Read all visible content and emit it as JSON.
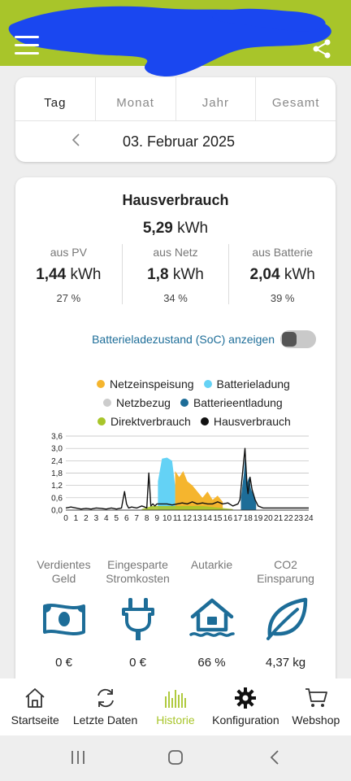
{
  "tabs": [
    {
      "label": "Tag",
      "active": true
    },
    {
      "label": "Monat",
      "active": false
    },
    {
      "label": "Jahr",
      "active": false
    },
    {
      "label": "Gesamt",
      "active": false
    }
  ],
  "date": "03. Februar 2025",
  "consumption": {
    "title": "Hausverbrauch",
    "total_value": "5,29",
    "unit": "kWh",
    "sources": [
      {
        "label": "aus PV",
        "value": "1,44",
        "unit": "kWh",
        "percent": "27 %"
      },
      {
        "label": "aus Netz",
        "value": "1,8",
        "unit": "kWh",
        "percent": "34 %"
      },
      {
        "label": "aus Batterie",
        "value": "2,04",
        "unit": "kWh",
        "percent": "39 %"
      }
    ]
  },
  "soc_toggle": {
    "label": "Batterieladezustand (SoC) anzeigen",
    "on": false
  },
  "legend": [
    {
      "name": "Netzeinspeisung",
      "color": "#f5b52e"
    },
    {
      "name": "Batterieladung",
      "color": "#64d2f5"
    },
    {
      "name": "Netzbezug",
      "color": "#cccccc"
    },
    {
      "name": "Batterieentladung",
      "color": "#1d6d98"
    },
    {
      "name": "Direktverbrauch",
      "color": "#a8c52a"
    },
    {
      "name": "Hausverbrauch",
      "color": "#111111"
    }
  ],
  "chart_data": {
    "type": "area",
    "x_ticks": [
      "0",
      "1",
      "2",
      "3",
      "4",
      "5",
      "6",
      "7",
      "8",
      "9",
      "10",
      "11",
      "12",
      "13",
      "14",
      "15",
      "16",
      "17",
      "18",
      "19",
      "20",
      "21",
      "22",
      "23",
      "24"
    ],
    "y_ticks": [
      "0,0",
      "0,6",
      "1,2",
      "1,8",
      "2,4",
      "3,0",
      "3,6"
    ],
    "ylim": [
      0,
      3.6
    ],
    "xlim": [
      0,
      24
    ],
    "grid": true,
    "series": [
      {
        "name": "Hausverbrauch",
        "x": [
          0,
          0.5,
          1,
          1.5,
          2,
          2.5,
          3,
          3.5,
          4,
          4.5,
          5,
          5.5,
          5.8,
          6,
          6.2,
          6.5,
          7,
          7.5,
          7.8,
          8,
          8.2,
          8.4,
          8.6,
          8.8,
          9,
          9.5,
          10,
          10.5,
          11,
          11.5,
          12,
          12.5,
          13,
          13.5,
          14,
          14.5,
          15,
          15.5,
          16,
          16.5,
          17,
          17.2,
          17.5,
          17.7,
          17.9,
          18,
          18.2,
          18.4,
          18.7,
          19,
          19.5,
          20,
          21,
          22,
          23,
          24
        ],
        "y": [
          0.1,
          0.15,
          0.1,
          0.05,
          0.08,
          0.05,
          0.1,
          0.08,
          0.05,
          0.1,
          0.05,
          0.1,
          0.9,
          0.3,
          0.1,
          0.15,
          0.1,
          0.2,
          0.15,
          0.1,
          1.8,
          0.2,
          0.3,
          0.2,
          0.3,
          0.3,
          0.3,
          0.25,
          0.3,
          0.35,
          0.3,
          0.4,
          0.3,
          0.35,
          0.3,
          0.3,
          0.4,
          0.3,
          0.35,
          0.2,
          0.3,
          0.5,
          2.0,
          3.0,
          1.2,
          0.8,
          1.6,
          1.0,
          0.5,
          0.2,
          0.1,
          0.1,
          0.1,
          0.1,
          0.1,
          0.1
        ]
      },
      {
        "name": "Batterieladung",
        "x": [
          9.1,
          9.5,
          10,
          10.5,
          10.8
        ],
        "y": [
          1.4,
          2.5,
          2.55,
          2.4,
          1.2
        ]
      },
      {
        "name": "Netzeinspeisung",
        "x": [
          10.8,
          11.2,
          11.6,
          12,
          12.5,
          13,
          13.5,
          14,
          14.5,
          15,
          15.5
        ],
        "y": [
          1.9,
          1.6,
          1.9,
          1.4,
          1.2,
          0.9,
          0.6,
          0.9,
          0.5,
          0.7,
          0.4
        ]
      },
      {
        "name": "Batterieentladung",
        "x": [
          17.3,
          17.6,
          17.75,
          17.9,
          18.1,
          18.3,
          18.5,
          18.8
        ],
        "y": [
          0.6,
          1.8,
          2.9,
          1.3,
          1.6,
          1.0,
          0.8,
          0.3
        ]
      },
      {
        "name": "Direktverbrauch",
        "x": [
          7.5,
          8.5,
          9.5,
          10.5,
          11.5,
          12.5,
          13.5,
          14.5,
          15.5,
          16.5
        ],
        "y": [
          0.05,
          0.2,
          0.2,
          0.2,
          0.2,
          0.2,
          0.2,
          0.15,
          0.1,
          0.05
        ]
      }
    ]
  },
  "kpis": [
    {
      "label": "Verdientes Geld",
      "value": "0 €",
      "icon": "money-icon"
    },
    {
      "label": "Eingesparte Stromkosten",
      "value": "0 €",
      "icon": "plug-icon"
    },
    {
      "label": "Autarkie",
      "value": "66 %",
      "icon": "house-icon"
    },
    {
      "label": "CO2 Einsparung",
      "value": "4,37 kg",
      "icon": "leaf-icon"
    }
  ],
  "nav": [
    {
      "label": "Startseite",
      "icon": "home-icon"
    },
    {
      "label": "Letzte Daten",
      "icon": "refresh-icon"
    },
    {
      "label": "Historie",
      "icon": "history-icon",
      "active": true
    },
    {
      "label": "Konfiguration",
      "icon": "settings-icon"
    },
    {
      "label": "Webshop",
      "icon": "cart-icon"
    }
  ],
  "colors": {
    "brand": "#a8c52a",
    "accent": "#1d6d98",
    "redaction": "#1a47f0"
  }
}
